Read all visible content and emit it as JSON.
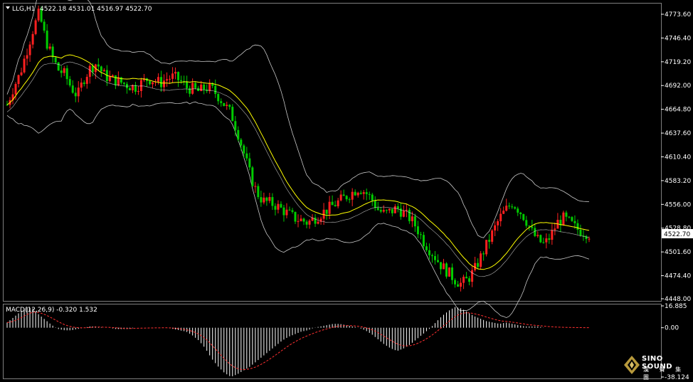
{
  "header": {
    "symbol_timeframe": "LLG,H1",
    "ohlc": "4522.18 4531.01 4516.97 4522.70"
  },
  "price_axis": {
    "ticks": [
      "4773.60",
      "4746.40",
      "4719.20",
      "4692.00",
      "4664.80",
      "4637.60",
      "4610.40",
      "4583.20",
      "4556.00",
      "4528.80",
      "4501.60",
      "4474.40",
      "4448.00"
    ],
    "current_price": "4522.70"
  },
  "macd_panel": {
    "label": "MACD(12,26,9) -0.320 1.532",
    "ticks": [
      "16.885",
      "0.00",
      "-38.124"
    ]
  },
  "logo": {
    "main": "SINO SOUND",
    "sub": "漢 聲 集 團"
  },
  "colors": {
    "background": "#000000",
    "bull_candle": "#ff2020",
    "bear_candle": "#00cc00",
    "bollinger": "#c8c8c8",
    "moving_average": "#ffff00",
    "macd_histogram": "#ffffff",
    "macd_signal": "#ff3030",
    "grid_border": "#808080"
  },
  "chart_data": {
    "type": "candlestick",
    "ylim": [
      4448.0,
      4785.0
    ],
    "trend_path": [
      4670,
      4690,
      4705,
      4730,
      4755,
      4775,
      4745,
      4725,
      4710,
      4705,
      4690,
      4680,
      4700,
      4712,
      4718,
      4705,
      4700,
      4698,
      4695,
      4692,
      4690,
      4695,
      4700,
      4698,
      4695,
      4700,
      4702,
      4698,
      4690,
      4688,
      4685,
      4690,
      4688,
      4680,
      4670,
      4660,
      4640,
      4615,
      4590,
      4570,
      4560,
      4558,
      4555,
      4550,
      4545,
      4540,
      4538,
      4535,
      4540,
      4545,
      4550,
      4555,
      4560,
      4565,
      4570,
      4575,
      4570,
      4562,
      4550,
      4545,
      4548,
      4552,
      4546,
      4540,
      4530,
      4515,
      4505,
      4495,
      4485,
      4478,
      4470,
      4465,
      4470,
      4480,
      4495,
      4510,
      4525,
      4540,
      4550,
      4558,
      4550,
      4540,
      4525,
      4515,
      4510,
      4520,
      4535,
      4540,
      4535,
      4528,
      4525,
      4522
    ],
    "macd_ylim": [
      -38.124,
      16.885
    ],
    "macd_trend": [
      4,
      8,
      12,
      16,
      15,
      10,
      6,
      2,
      -1,
      -2,
      -2,
      -1,
      0,
      1,
      1,
      0,
      0,
      -1,
      -1,
      -1,
      0,
      0,
      0,
      0,
      0,
      0,
      -1,
      -2,
      -3,
      -6,
      -10,
      -16,
      -24,
      -30,
      -35,
      -38,
      -36,
      -33,
      -30,
      -26,
      -22,
      -18,
      -14,
      -10,
      -7,
      -5,
      -3,
      -2,
      0,
      1,
      2,
      3,
      3,
      2,
      1,
      0,
      -2,
      -5,
      -9,
      -13,
      -16,
      -18,
      -16,
      -13,
      -9,
      -5,
      -1,
      4,
      9,
      13,
      16,
      15,
      12,
      9,
      7,
      5,
      4,
      3,
      4,
      3,
      2,
      1,
      1,
      1,
      0,
      0,
      0,
      0,
      0,
      0,
      0,
      0
    ]
  }
}
